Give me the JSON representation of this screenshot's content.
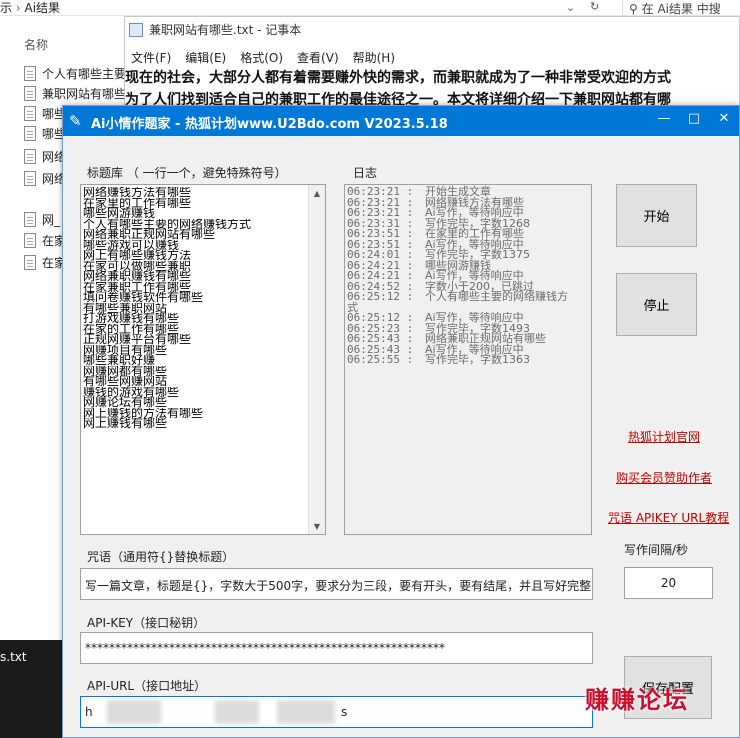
{
  "explorer": {
    "path_prefix": "示",
    "path_sep": "›",
    "path_folder": "Ai结果",
    "search_placeholder": "在 Ai结果 中搜",
    "column_name": "名称",
    "files": [
      "个人有哪些主要",
      "兼职网站有哪些",
      "哪些",
      "哪些",
      "网络",
      "网络",
      "网_",
      "在家",
      "在家"
    ],
    "taskbar_label": "s.txt"
  },
  "notepad": {
    "title": "兼职网站有哪些.txt - 记事本",
    "menu": [
      "文件(F)",
      "编辑(E)",
      "格式(O)",
      "查看(V)",
      "帮助(H)"
    ],
    "line1": "现在的社会，大部分人都有着需要赚外快的需求，而兼职就成为了一种非常受欢迎的方式",
    "line2": "为了人们找到适合自己的兼职工作的最佳途径之一。本文将详细介绍一下兼职网站都有哪"
  },
  "app": {
    "title": "Ai小情作题家 - 热狐计划www.U2Bdo.com V2023.5.18",
    "controls": [
      "—",
      "□",
      "✕"
    ],
    "titles_label": "标题库 （ 一行一个，避免特殊符号）",
    "log_label": "日志",
    "titles": [
      "网络赚钱方法有哪些",
      "在家里的工作有哪些",
      "哪些网游赚钱",
      "个人有哪些主要的网络赚钱方式",
      "网络兼职正规网站有哪些",
      "哪些游戏可以赚钱",
      "网上有哪些赚钱方法",
      "在家可以做哪些兼职",
      "网络兼职赚钱有哪些",
      "在家兼职工作有哪些",
      "填问卷赚钱软件有哪些",
      "有哪些兼职网站",
      "打游戏赚钱有哪些",
      "在家的工作有哪些",
      "正规网赚平台有哪些",
      "网赚项目有哪些",
      "哪些兼职好赚",
      "网赚网都有哪些",
      "有哪些网赚网站",
      "赚钱的游戏有哪些",
      "网赚论坛有哪些",
      "网上赚钱的方法有哪些",
      "网上赚钱有哪些"
    ],
    "log": [
      {
        "time": "06:23:21 :",
        "msg": "开始生成文章"
      },
      {
        "time": "06:23:21 :",
        "msg": "网络赚钱方法有哪些"
      },
      {
        "time": "06:23:21 :",
        "msg": "Ai写作，等待响应中"
      },
      {
        "time": "06:23:31 :",
        "msg": "写作完毕，字数1268"
      },
      {
        "time": "06:23:51 :",
        "msg": "在家里的工作有哪些"
      },
      {
        "time": "06:23:51 :",
        "msg": "Ai写作，等待响应中"
      },
      {
        "time": "06:24:01 :",
        "msg": "写作完毕，字数1375"
      },
      {
        "time": "06:24:21 :",
        "msg": "哪些网游赚钱"
      },
      {
        "time": "06:24:21 :",
        "msg": "Ai写作，等待响应中"
      },
      {
        "time": "06:24:52 :",
        "msg": "字数小于200，已跳过"
      },
      {
        "time": "06:25:12 :",
        "msg": "个人有哪些主要的网络赚钱方"
      },
      {
        "time": "式",
        "msg": ""
      },
      {
        "time": "06:25:12 :",
        "msg": "Ai写作，等待响应中"
      },
      {
        "time": "06:25:23 :",
        "msg": "写作完毕，字数1493"
      },
      {
        "time": "06:25:43 :",
        "msg": "网络兼职正规网站有哪些"
      },
      {
        "time": "06:25:43 :",
        "msg": "Ai写作，等待响应中"
      },
      {
        "time": "06:25:55 :",
        "msg": "写作完毕，字数1363"
      }
    ],
    "start_button": "开始",
    "stop_button": "停止",
    "link_official": "热狐计划官网",
    "link_buy": "购买会员赞助作者",
    "link_tutorial": "咒语 APIKEY URL教程",
    "interval_label": "写作间隔/秒",
    "interval_value": "20",
    "prompt_label": "咒语（通用符{}替换标题）",
    "prompt_value": "写一篇文章，标题是{}，字数大于500字，要求分为三段，要有开头，要有结尾，并且写好完整的",
    "apikey_label": "API-KEY（接口秘钥）",
    "apikey_value": "************************************************************",
    "apiurl_label": "API-URL（接口地址）",
    "apiurl_value_start": "h",
    "apiurl_value_end": "s",
    "save_button": "保存配置"
  },
  "watermark": "赚赚论坛"
}
